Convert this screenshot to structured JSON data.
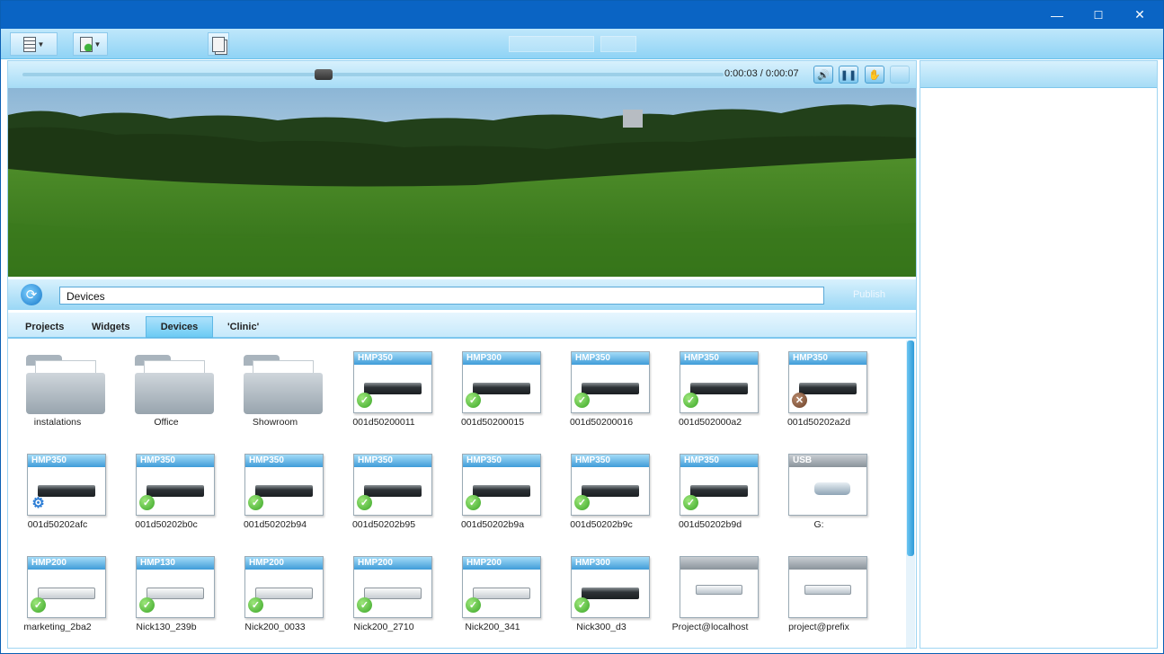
{
  "window": {
    "minimize": "—",
    "maximize": "☐",
    "close": "✕"
  },
  "toolbar": {
    "menu_icon": "list-icon",
    "add_icon": "add-file-icon",
    "copy_icon": "copy-icon"
  },
  "player": {
    "time": "0:00:03 / 0:00:07",
    "progress": 0.43,
    "icons": [
      "volume-icon",
      "pause-icon",
      "hand-icon"
    ]
  },
  "path": {
    "value": "Devices",
    "publish_label": "Publish"
  },
  "tabs": [
    "Projects",
    "Widgets",
    "Devices",
    "'Clinic'"
  ],
  "active_tab": "Devices",
  "items": [
    {
      "kind": "folder",
      "label": "instalations"
    },
    {
      "kind": "folder",
      "label": "Office"
    },
    {
      "kind": "folder",
      "label": "Showroom"
    },
    {
      "kind": "device",
      "model": "HMP350",
      "label": "001d50200011",
      "status": "ok"
    },
    {
      "kind": "device",
      "model": "HMP300",
      "label": "001d50200015",
      "status": "ok"
    },
    {
      "kind": "device",
      "model": "HMP350",
      "label": "001d50200016",
      "status": "ok"
    },
    {
      "kind": "device",
      "model": "HMP350",
      "label": "001d502000a2",
      "status": "ok"
    },
    {
      "kind": "device",
      "model": "HMP350",
      "label": "001d50202a2d",
      "status": "error"
    },
    {
      "kind": "device",
      "model": "HMP350",
      "label": "001d50202afc",
      "status": "configuring"
    },
    {
      "kind": "device",
      "model": "HMP350",
      "label": "001d50202b0c",
      "status": "ok"
    },
    {
      "kind": "device",
      "model": "HMP350",
      "label": "001d50202b94",
      "status": "ok"
    },
    {
      "kind": "device",
      "model": "HMP350",
      "label": "001d50202b95",
      "status": "ok"
    },
    {
      "kind": "device",
      "model": "HMP350",
      "label": "001d50202b9a",
      "status": "ok"
    },
    {
      "kind": "device",
      "model": "HMP350",
      "label": "001d50202b9c",
      "status": "ok"
    },
    {
      "kind": "device",
      "model": "HMP350",
      "label": "001d50202b9d",
      "status": "ok"
    },
    {
      "kind": "usb",
      "model": "USB",
      "label": "G:"
    },
    {
      "kind": "device-light",
      "model": "HMP200",
      "label": "marketing_2ba2",
      "status": "ok"
    },
    {
      "kind": "device-light",
      "model": "HMP130",
      "label": "Nick130_239b",
      "status": "ok"
    },
    {
      "kind": "device-light",
      "model": "HMP200",
      "label": "Nick200_0033",
      "status": "ok"
    },
    {
      "kind": "device-light",
      "model": "HMP200",
      "label": "Nick200_2710",
      "status": "ok"
    },
    {
      "kind": "device-light",
      "model": "HMP200",
      "label": "Nick200_341",
      "status": "ok"
    },
    {
      "kind": "device",
      "model": "HMP300",
      "label": "Nick300_d3",
      "status": "ok"
    },
    {
      "kind": "server",
      "model": "",
      "label": "Project@localhost"
    },
    {
      "kind": "server",
      "model": "",
      "label": "project@prefix"
    }
  ]
}
